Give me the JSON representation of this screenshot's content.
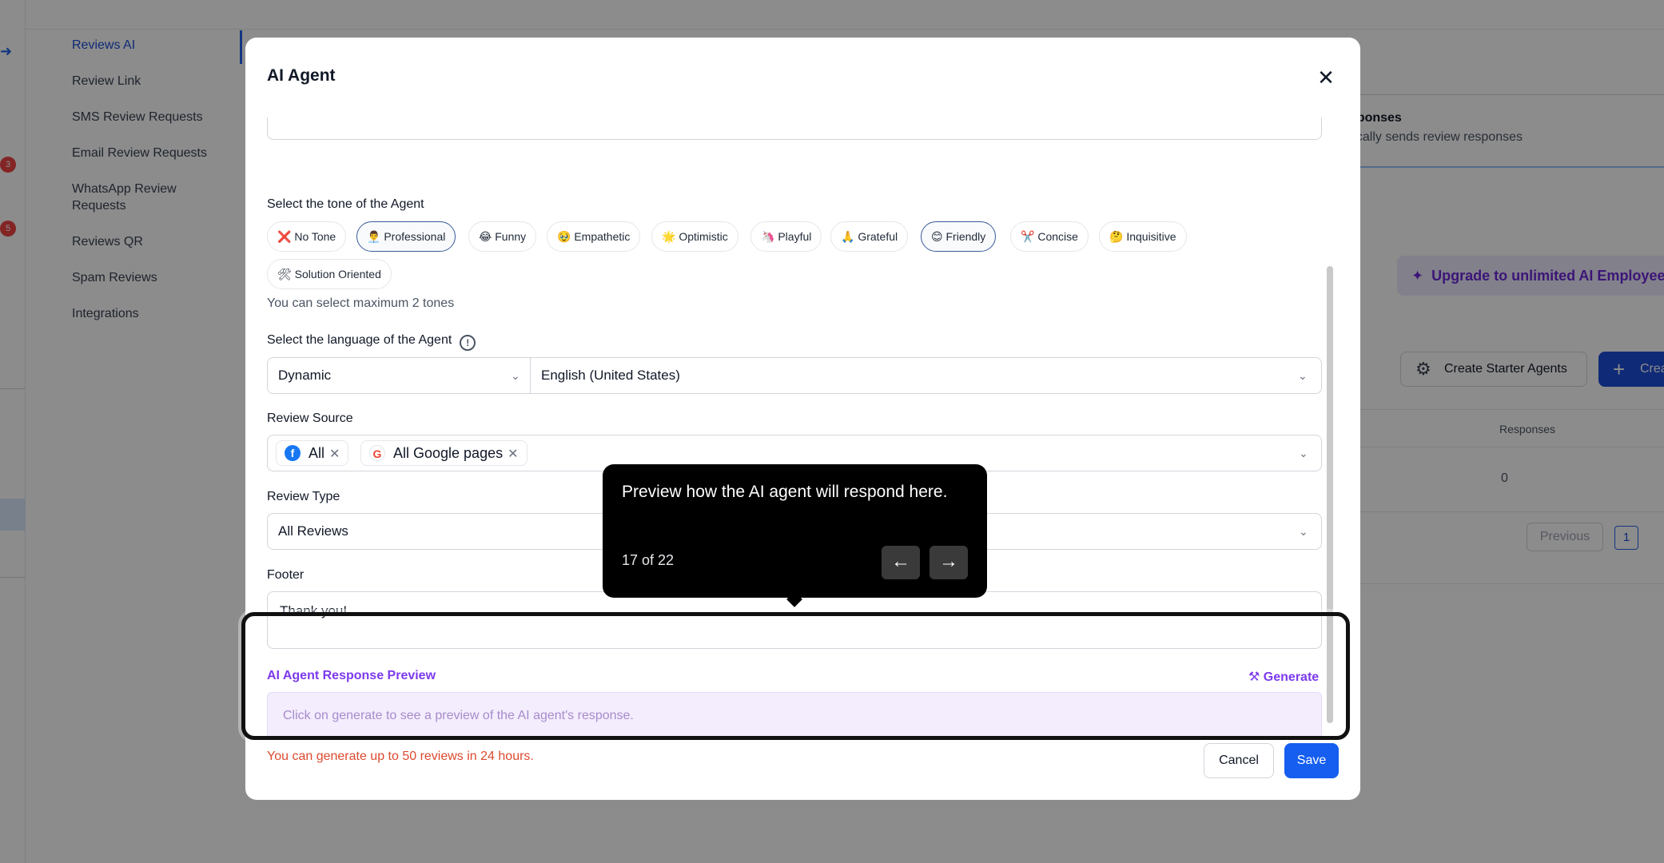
{
  "sidebar": {
    "badges": [
      "3",
      "5"
    ],
    "items": [
      {
        "label": "Reviews AI"
      },
      {
        "label": "Review Link"
      },
      {
        "label": "SMS Review Requests"
      },
      {
        "label": "Email Review Requests"
      },
      {
        "label": "WhatsApp Review Requests"
      },
      {
        "label": "Reviews QR"
      },
      {
        "label": "Spam Reviews"
      },
      {
        "label": "Integrations"
      }
    ]
  },
  "background": {
    "responses_title": "esponses",
    "responses_sub": "atically sends review responses",
    "upgrade_label": "Upgrade to unlimited AI Employee p",
    "starter_label": "Create Starter Agents",
    "create_label": "Crea",
    "col_responses": "Responses",
    "row_value": "0",
    "prev_label": "Previous",
    "page_number": "1"
  },
  "modal": {
    "title": "AI Agent",
    "tone_label": "Select the tone of the Agent",
    "tones": [
      {
        "icon": "❌",
        "label": "No Tone"
      },
      {
        "icon": "👨‍💼",
        "label": "Professional"
      },
      {
        "icon": "😂",
        "label": "Funny"
      },
      {
        "icon": "🥹",
        "label": "Empathetic"
      },
      {
        "icon": "🌟",
        "label": "Optimistic"
      },
      {
        "icon": "🦄",
        "label": "Playful"
      },
      {
        "icon": "🙏",
        "label": "Grateful"
      },
      {
        "icon": "😊",
        "label": "Friendly"
      },
      {
        "icon": "✂️",
        "label": "Concise"
      },
      {
        "icon": "🤔",
        "label": "Inquisitive"
      },
      {
        "icon": "🛠",
        "label": "Solution Oriented"
      }
    ],
    "tone_hint": "You can select maximum 2 tones",
    "language_label": "Select the language of the Agent",
    "language_mode": "Dynamic",
    "language_value": "English (United States)",
    "source_label": "Review Source",
    "source_tags": [
      "All",
      "All Google pages"
    ],
    "type_label": "Review Type",
    "type_value": "All Reviews",
    "footer_label": "Footer",
    "footer_value": "Thank you!",
    "preview_title": "AI Agent Response Preview",
    "generate_label": "Generate",
    "preview_placeholder": "Click on generate to see a preview of the AI agent's response.",
    "limit_text": "You can generate up to 50 reviews in 24 hours.",
    "cancel_label": "Cancel",
    "save_label": "Save"
  },
  "tooltip": {
    "text": "Preview how the AI agent will respond here.",
    "step": "17 of 22"
  }
}
